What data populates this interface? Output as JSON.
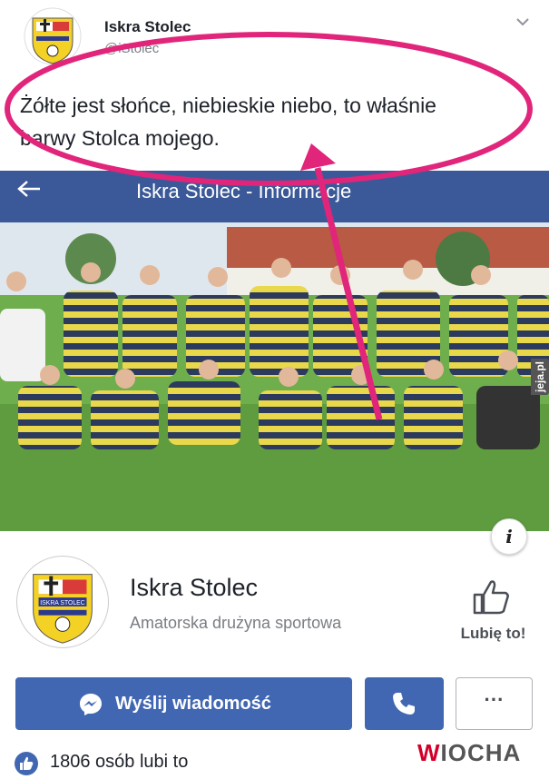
{
  "post": {
    "author": "Iskra Stolec",
    "handle": "@iStolec",
    "text_line1": "Żółte jest słońce, niebieskie niebo, to właśnie",
    "text_line2": "barwy Stolca mojego."
  },
  "header": {
    "title": "Iskra Stolec - Informacje",
    "back_icon": "arrow-left-icon"
  },
  "page": {
    "name": "Iskra Stolec",
    "category": "Amatorska drużyna sportowa",
    "like_label": "Lubię to!",
    "logo_text": "ISKRA STOLEC"
  },
  "actions": {
    "message_label": "Wyślij wiadomość",
    "call_icon": "phone-icon",
    "more_label": "···"
  },
  "stats": {
    "likes_text": "1806 osób lubi to"
  },
  "watermark": {
    "w": "W",
    "rest": "IOCHA",
    "side": "jeja.pl"
  },
  "colors": {
    "facebook_blue": "#3b5998",
    "button_blue": "#4267b2",
    "annotation_pink": "#e0257a",
    "jersey_yellow": "#e8d84a",
    "jersey_navy": "#2c3a5e"
  }
}
